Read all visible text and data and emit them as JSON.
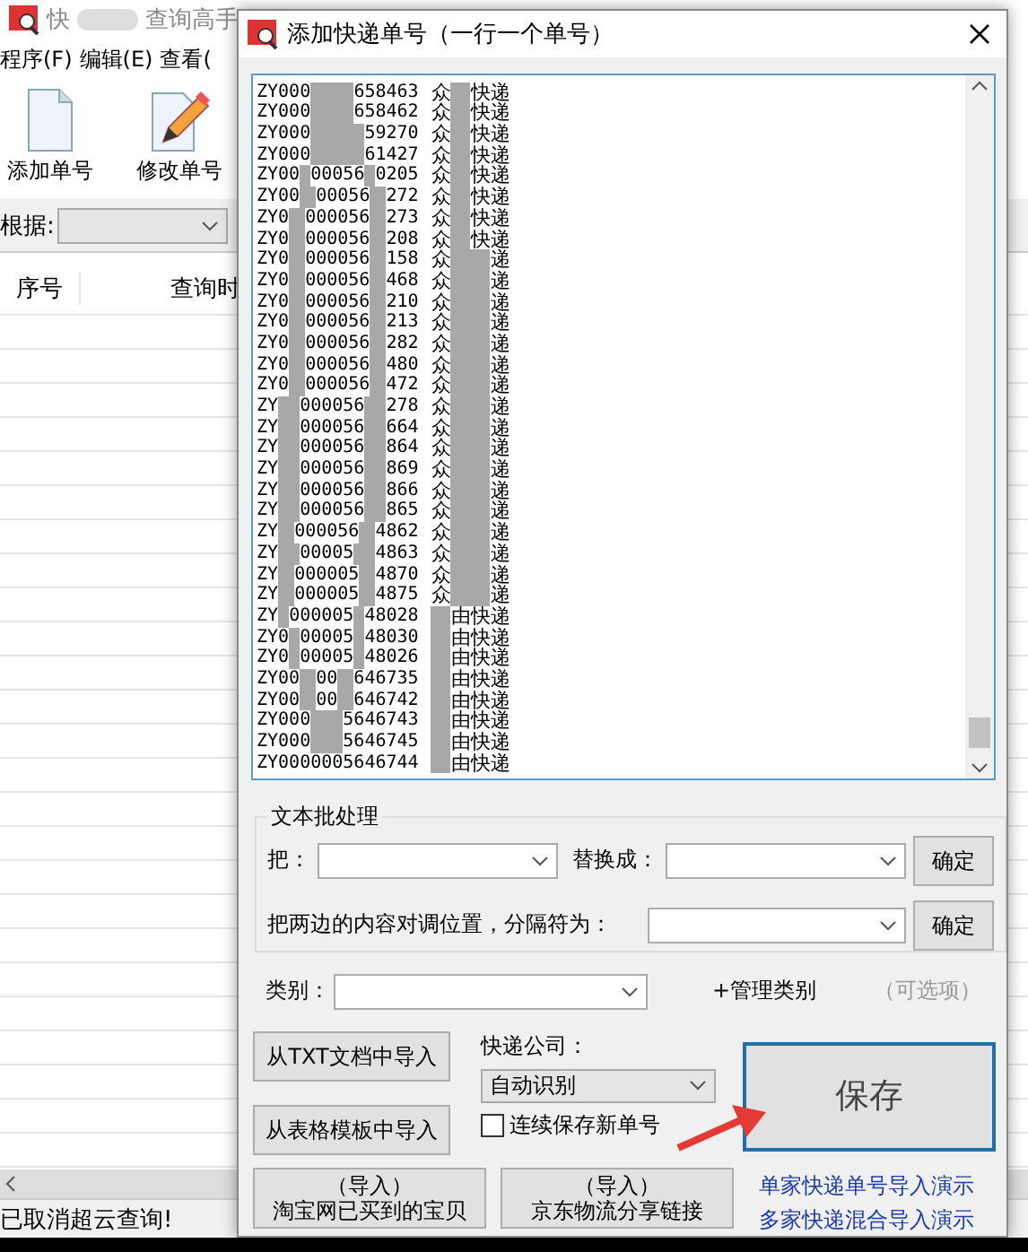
{
  "main_window": {
    "title_parts": [
      "快",
      "查询高手"
    ],
    "menu": [
      "程序(F)",
      "编辑(E)",
      "查看("
    ],
    "toolbar": [
      {
        "label": "添加单号",
        "kind": "document"
      },
      {
        "label": "修改单号",
        "kind": "edit"
      }
    ],
    "filter": {
      "label": "根据:"
    },
    "table": {
      "columns": [
        "序号",
        "查询时"
      ]
    },
    "status_bar": "已取消超云查询!"
  },
  "dialog": {
    "title": "添加快递单号（一行一个单号）",
    "rows": [
      {
        "id": [
          "ZY000",
          "658463"
        ],
        "carrier": [
          "众",
          "快递"
        ]
      },
      {
        "id": [
          "ZY000",
          "658462"
        ],
        "carrier": [
          "众",
          "快递"
        ]
      },
      {
        "id": [
          "ZY000",
          "59270"
        ],
        "carrier": [
          "众",
          "快递"
        ]
      },
      {
        "id": [
          "ZY000",
          "61427"
        ],
        "carrier": [
          "众",
          "快递"
        ]
      },
      {
        "id": [
          "ZY00",
          "00056",
          "0205"
        ],
        "carrier": [
          "众",
          "快递"
        ]
      },
      {
        "id": [
          "ZY00",
          "00056",
          "272"
        ],
        "carrier": [
          "众",
          "快递"
        ]
      },
      {
        "id": [
          "ZY0",
          "000056",
          "273"
        ],
        "carrier": [
          "众",
          "快递"
        ]
      },
      {
        "id": [
          "ZY0",
          "000056",
          "208"
        ],
        "carrier": [
          "众",
          "快递"
        ]
      },
      {
        "id": [
          "ZY0",
          "000056",
          "158"
        ],
        "carrier": [
          "众",
          "递"
        ]
      },
      {
        "id": [
          "ZY0",
          "000056",
          "468"
        ],
        "carrier": [
          "众",
          "递"
        ]
      },
      {
        "id": [
          "ZY0",
          "000056",
          "210"
        ],
        "carrier": [
          "众",
          "递"
        ]
      },
      {
        "id": [
          "ZY0",
          "000056",
          "213"
        ],
        "carrier": [
          "众",
          "递"
        ]
      },
      {
        "id": [
          "ZY0",
          "000056",
          "282"
        ],
        "carrier": [
          "众",
          "递"
        ]
      },
      {
        "id": [
          "ZY0",
          "000056",
          "480"
        ],
        "carrier": [
          "众",
          "递"
        ]
      },
      {
        "id": [
          "ZY0",
          "000056",
          "472"
        ],
        "carrier": [
          "众",
          "递"
        ]
      },
      {
        "id": [
          "ZY",
          "000056",
          "278"
        ],
        "carrier": [
          "众",
          "递"
        ]
      },
      {
        "id": [
          "ZY",
          "000056",
          "664"
        ],
        "carrier": [
          "众",
          "递"
        ]
      },
      {
        "id": [
          "ZY",
          "000056",
          "864"
        ],
        "carrier": [
          "众",
          "递"
        ]
      },
      {
        "id": [
          "ZY",
          "000056",
          "869"
        ],
        "carrier": [
          "众",
          "递"
        ]
      },
      {
        "id": [
          "ZY",
          "000056",
          "866"
        ],
        "carrier": [
          "众",
          "递"
        ]
      },
      {
        "id": [
          "ZY",
          "000056",
          "865"
        ],
        "carrier": [
          "众",
          "递"
        ]
      },
      {
        "id": [
          "ZY",
          "000056",
          "4862"
        ],
        "carrier": [
          "众",
          "递"
        ]
      },
      {
        "id": [
          "ZY",
          "00005",
          "4863"
        ],
        "carrier": [
          "众",
          "递"
        ]
      },
      {
        "id": [
          "ZY",
          "000005",
          "4870"
        ],
        "carrier": [
          "众",
          "递"
        ]
      },
      {
        "id": [
          "ZY",
          "000005",
          "4875"
        ],
        "carrier": [
          "众",
          "递"
        ]
      },
      {
        "id": [
          "ZY",
          "000005",
          "48028"
        ],
        "carrier": [
          "由快递"
        ]
      },
      {
        "id": [
          "ZY0",
          "00005",
          "48030"
        ],
        "carrier": [
          "由快递"
        ]
      },
      {
        "id": [
          "ZY0",
          "00005",
          "48026"
        ],
        "carrier": [
          "由快递"
        ]
      },
      {
        "id": [
          "ZY00",
          "00",
          "646735"
        ],
        "carrier": [
          "由快递"
        ]
      },
      {
        "id": [
          "ZY00",
          "00",
          "646742"
        ],
        "carrier": [
          "由快递"
        ]
      },
      {
        "id": [
          "ZY000",
          "5646743"
        ],
        "carrier": [
          "由快递"
        ]
      },
      {
        "id": [
          "ZY000",
          "5646745"
        ],
        "carrier": [
          "由快递"
        ]
      },
      {
        "id": [
          "ZY0000005646744"
        ],
        "carrier": [
          "由快递"
        ]
      }
    ],
    "batch": {
      "title": "文本批处理",
      "replace_from_label": "把：",
      "replace_to_label": "替换成：",
      "swap_label": "把两边的内容对调位置，分隔符为：",
      "confirm_buttons": [
        "确定",
        "确定"
      ]
    },
    "category": {
      "label": "类别：",
      "manage_link": "+管理类别",
      "hint": "（可选项）"
    },
    "import_buttons": [
      "从TXT文档中导入",
      "从表格模板中导入"
    ],
    "courier": {
      "label": "快递公司：",
      "value": "自动识别"
    },
    "continuous_save": {
      "label": "连续保存新单号",
      "checked": false
    },
    "save_button": "保存",
    "bottom_buttons": [
      {
        "top": "（导入）",
        "bottom": "淘宝网已买到的宝贝"
      },
      {
        "top": "（导入）",
        "bottom": "京东物流分享链接"
      }
    ],
    "links": [
      "单家快递单号导入演示",
      "多家快递混合导入演示"
    ]
  }
}
